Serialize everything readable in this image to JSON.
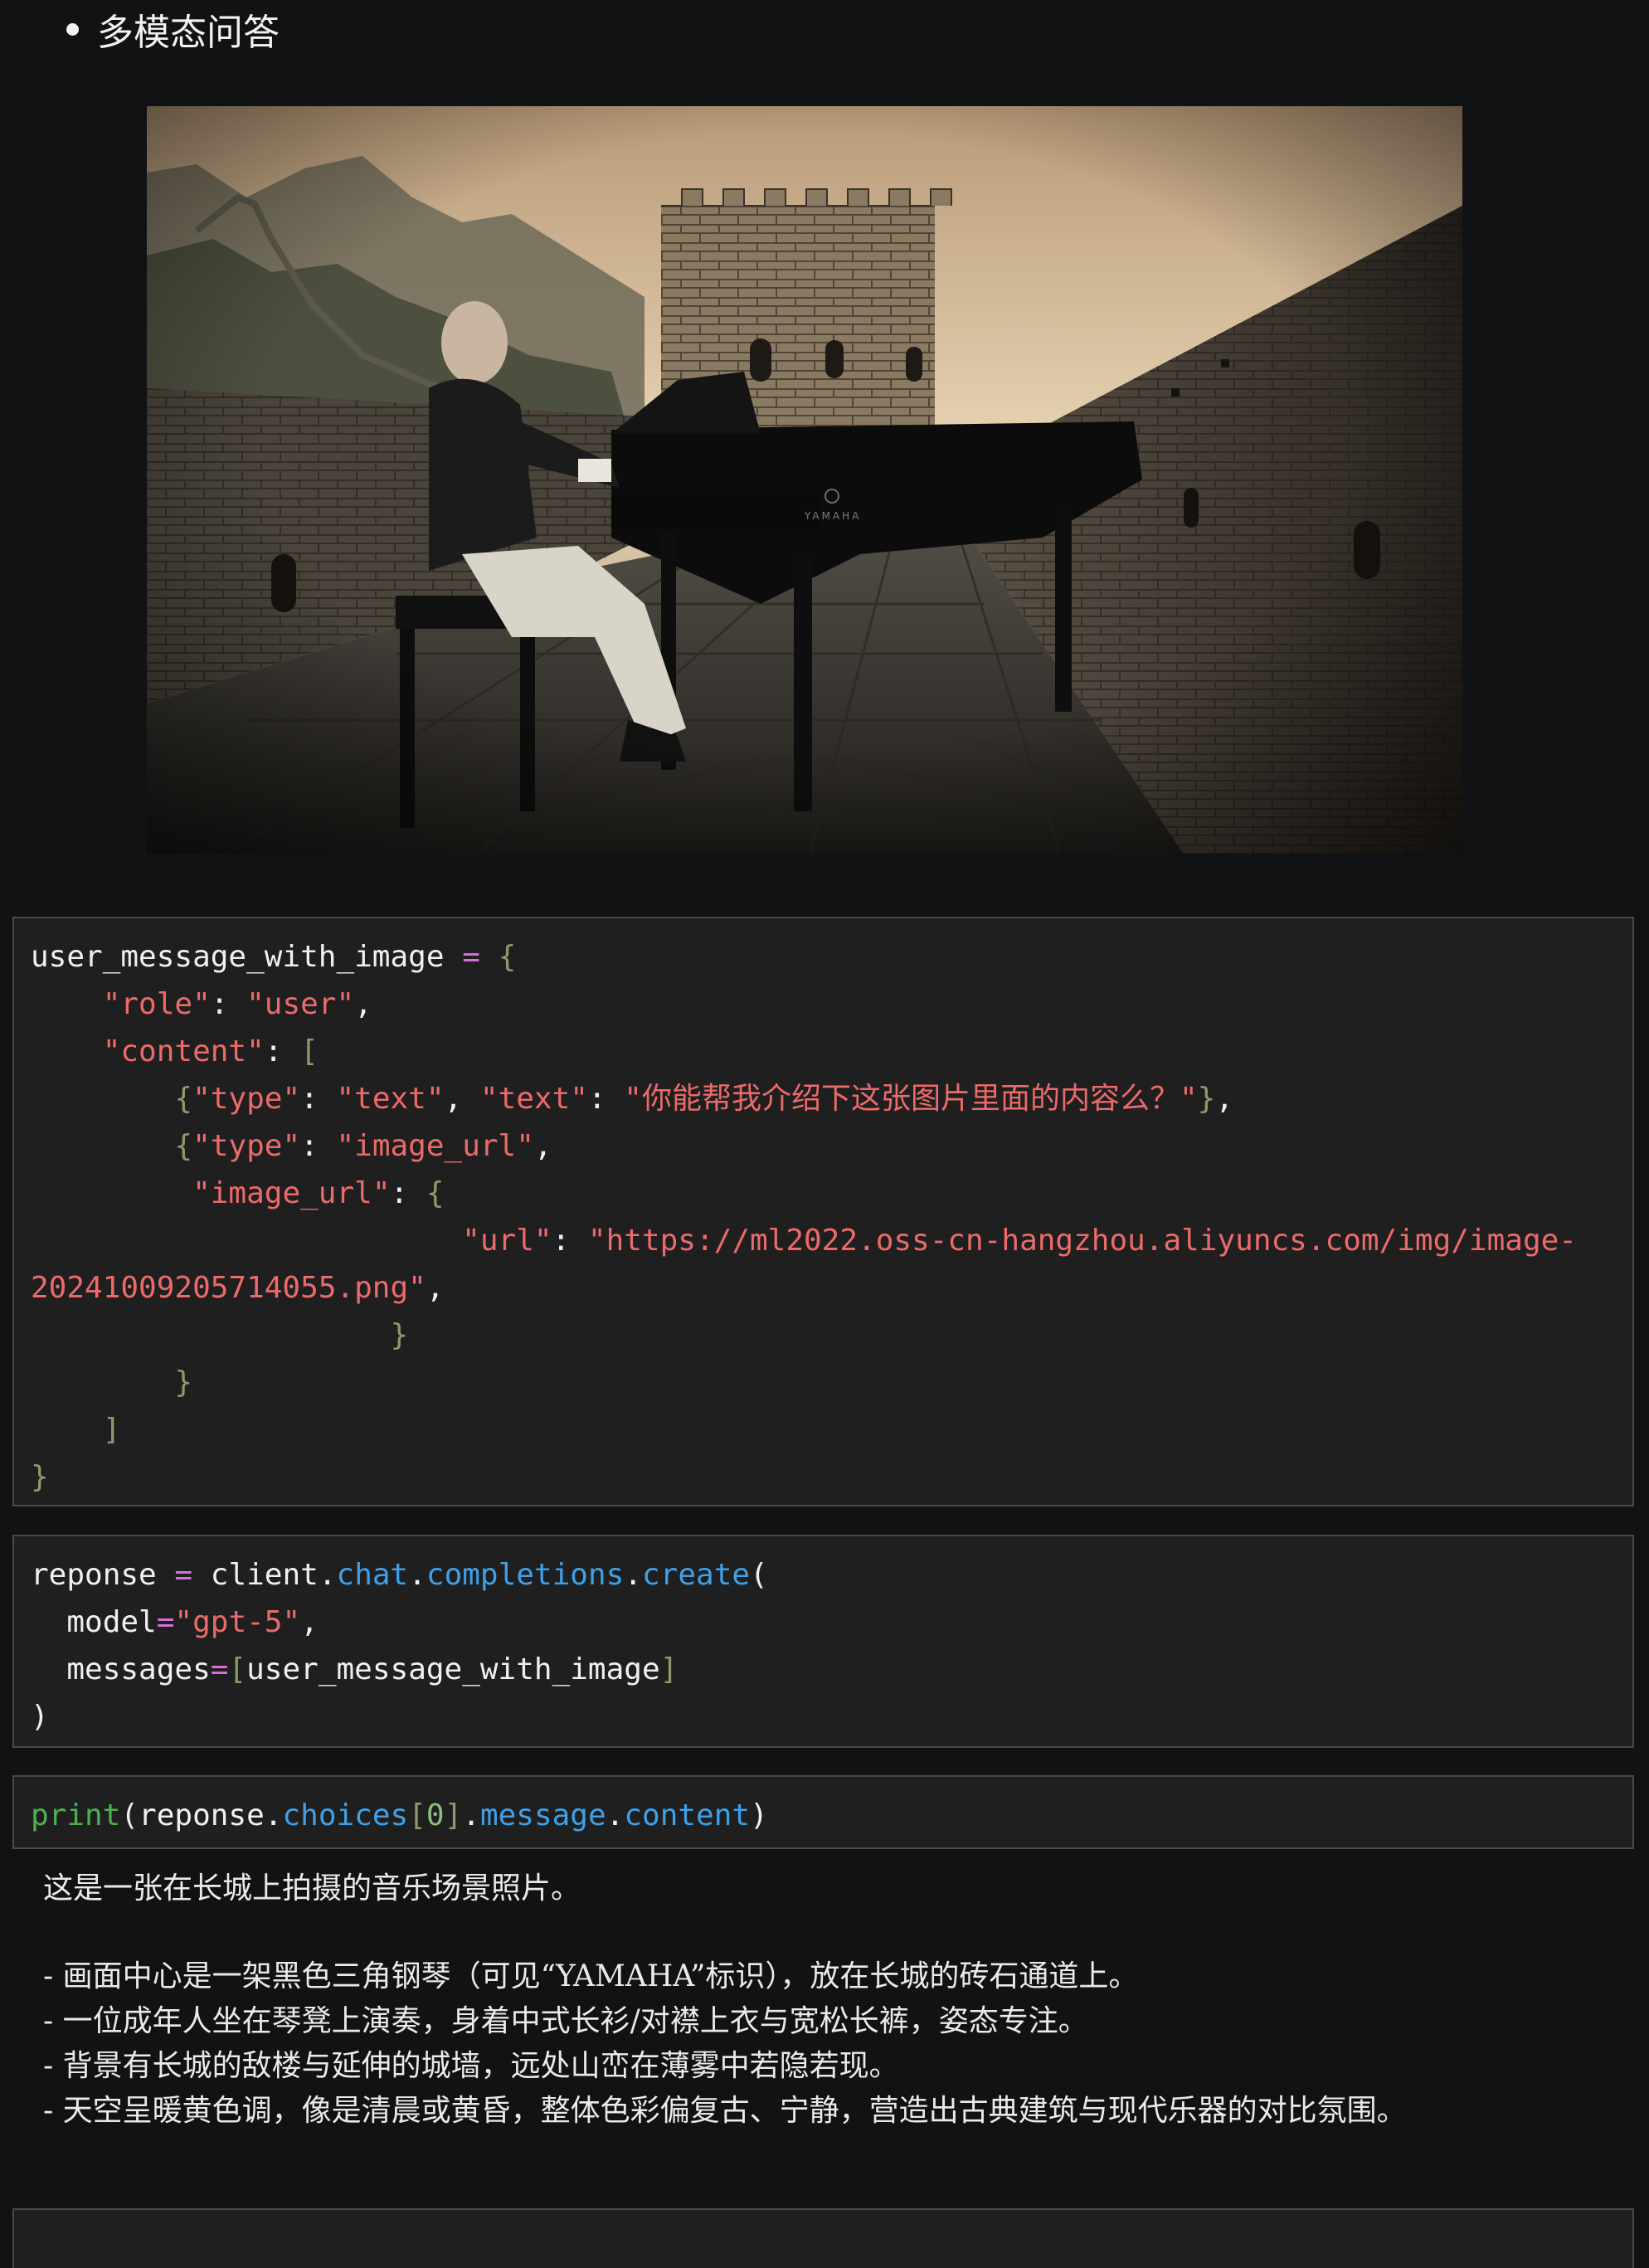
{
  "heading": {
    "text": "多模态问答"
  },
  "image": {
    "description_icon": "photo-great-wall-piano",
    "caption_text": "YAMAHA"
  },
  "cells": {
    "message": {
      "l1_var": "user_message_with_image",
      "l1_op": "=",
      "l1_open": "{",
      "l2_key": "\"role\"",
      "l2_val": "\"user\"",
      "l3_key": "\"content\"",
      "l3_open": "[",
      "l4_type_key": "\"type\"",
      "l4_type_val": "\"text\"",
      "l4_text_key": "\"text\"",
      "l4_text_val": "\"你能帮我介绍下这张图片里面的内容么？\"",
      "l5_type_key": "\"type\"",
      "l5_type_val": "\"image_url\"",
      "l6_key": "\"image_url\"",
      "l7_key": "\"url\"",
      "l7_val_a": "\"https://ml2022.oss-cn-hangzhou.aliyuncs.com/img/image-",
      "l8_val_b": "20241009205714055.png\"",
      "close_brace": "}",
      "close_bracket": "]"
    },
    "request": {
      "var": "reponse",
      "op": "=",
      "obj": "client",
      "attr1": "chat",
      "attr2": "completions",
      "attr3": "create",
      "model_kw": "model",
      "model_val": "\"gpt-5\"",
      "messages_kw": "messages",
      "messages_arg": "user_message_with_image"
    },
    "print": {
      "fn": "print",
      "var": "reponse",
      "attr1": "choices",
      "index": "0",
      "attr2": "message",
      "attr3": "content"
    }
  },
  "output": {
    "intro": "这是一张在长城上拍摄的音乐场景照片。",
    "bullets": [
      "- 画面中心是一架黑色三角钢琴（可见“YAMAHA”标识），放在长城的砖石通道上。",
      "- 一位成年人坐在琴凳上演奏，身着中式长衫/对襟上衣与宽松长裤，姿态专注。",
      "- 背景有长城的敌楼与延伸的城墙，远处山峦在薄雾中若隐若现。",
      "- 天空呈暖黄色调，像是清晨或黄昏，整体色彩偏复古、宁静，营造出古典建筑与现代乐器的对比氛围。"
    ]
  }
}
